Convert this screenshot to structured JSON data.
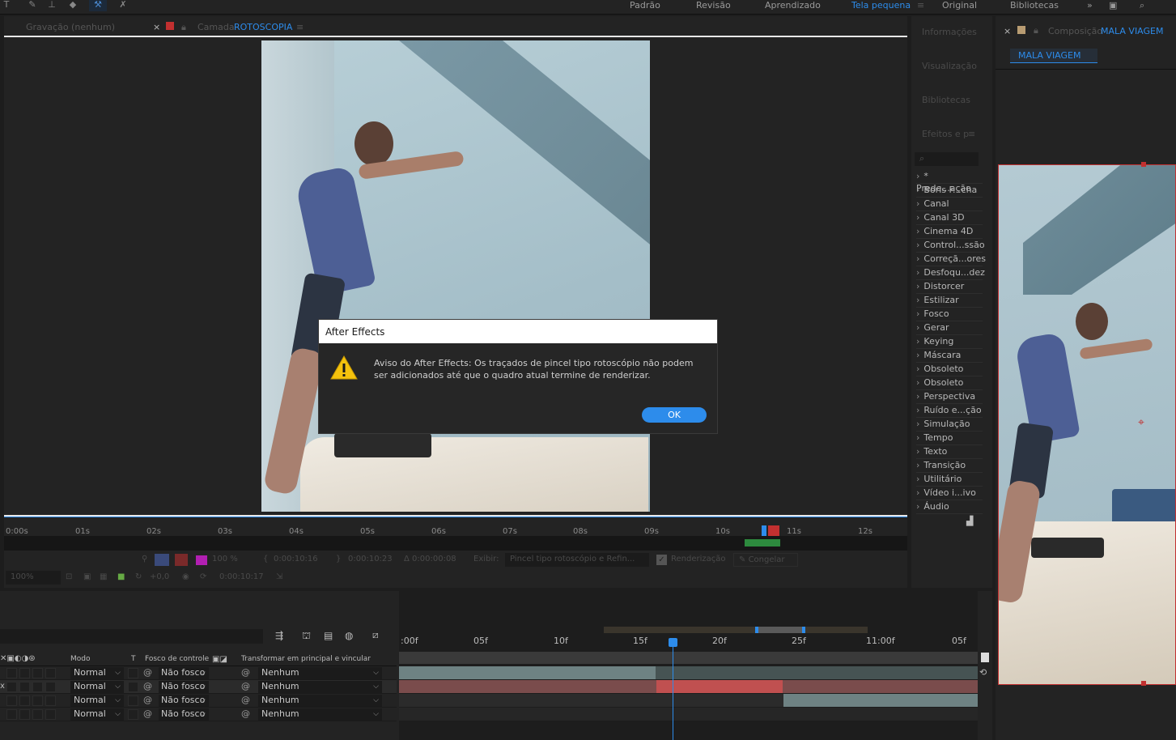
{
  "workspaces": {
    "items": [
      "Padrão",
      "Revisão",
      "Aprendizado",
      "Tela pequena",
      "Original",
      "Bibliotecas"
    ],
    "active": "Tela pequena"
  },
  "layer_panel": {
    "tab_gravacao": "Gravação  (nenhum)",
    "tab_close": "×",
    "tab_prefix": "Camada",
    "tab_name": "ROTOSCOPIA",
    "ruler_ticks": [
      "0:00s",
      "01s",
      "02s",
      "03s",
      "04s",
      "05s",
      "06s",
      "07s",
      "08s",
      "09s",
      "10s",
      "11s",
      "12s"
    ],
    "opacity": "100 %",
    "time_in": "0:00:10:16",
    "time_out": "0:00:10:23",
    "duration": "Δ 0:00:00:08",
    "exibir_label": "Exibir:",
    "exibir_value": "Pincel tipo rotoscópio e Refin...",
    "render_label": "Renderização",
    "freeze_label": "Congelar",
    "zoom": "100%",
    "exposure": "+0,0",
    "current_time": "0:00:10:17"
  },
  "effects_panel": {
    "sections": [
      "Informações",
      "Visualização",
      "Bibliotecas",
      "Efeitos e p"
    ],
    "search_placeholder": "⌕",
    "items": [
      "* Prede...ação",
      "Boris F...cha",
      "Canal",
      "Canal 3D",
      "Cinema 4D",
      "Control...ssão",
      "Correçã...ores",
      "Desfoqu...dez",
      "Distorcer",
      "Estilizar",
      "Fosco",
      "Gerar",
      "Keying",
      "Máscara",
      "Obsoleto",
      "Obsoleto",
      "Perspectiva",
      "Ruído e...ção",
      "Simulação",
      "Tempo",
      "Texto",
      "Transição",
      "Utilitário",
      "Vídeo i...ivo",
      "Áudio"
    ]
  },
  "comp_panel": {
    "close": "×",
    "prefix": "Composição",
    "name": "MALA VIAGEM",
    "tab": "MALA VIAGEM"
  },
  "timeline": {
    "col_modo": "Modo",
    "col_t": "T",
    "col_fosco": "Fosco de controle",
    "col_transform": "Transformar em principal e vincular",
    "ticks": [
      ":00f",
      "05f",
      "10f",
      "15f",
      "20f",
      "25f",
      "11:00f",
      "05f"
    ],
    "layers": [
      {
        "mode": "Normal",
        "fosco": "Não fosco",
        "parent": "Nenhum"
      },
      {
        "mode": "Normal",
        "fosco": "Não fosco",
        "parent": "Nenhum"
      },
      {
        "mode": "Normal",
        "fosco": "Não fosco",
        "parent": "Nenhum"
      },
      {
        "mode": "Normal",
        "fosco": "Não fosco",
        "parent": "Nenhum"
      }
    ]
  },
  "dialog": {
    "title": "After Effects",
    "message": "Aviso do After Effects: Os traçados de pincel tipo rotoscópio não podem ser adicionados até que o quadro atual termine de renderizar.",
    "ok_label": "OK",
    "icon": "warning-icon"
  }
}
